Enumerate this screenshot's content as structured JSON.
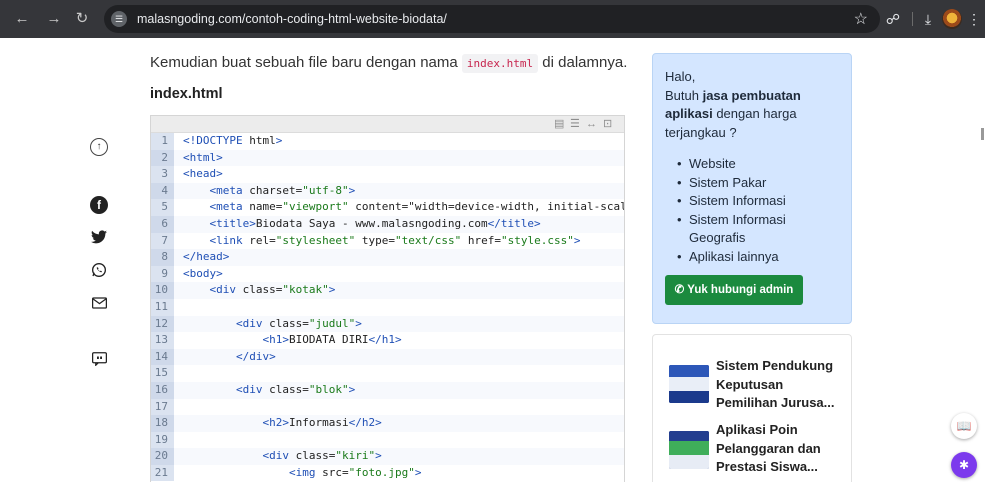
{
  "browser": {
    "url": "malasngoding.com/contoh-coding-html-website-biodata/",
    "icons": [
      "back-icon",
      "forward-icon",
      "reload-icon",
      "site-info-icon",
      "bookmark-star-icon",
      "extensions-icon",
      "download-icon",
      "profile-avatar"
    ]
  },
  "article": {
    "intro_before": "Kemudian buat sebuah file baru dengan nama ",
    "intro_code": "index.html",
    "intro_after": " di dalamnya.",
    "file_heading": "index.html"
  },
  "code_lines": [
    {
      "n": "1",
      "t": "<!DOCTYPE html>"
    },
    {
      "n": "2",
      "t": "<html>"
    },
    {
      "n": "3",
      "t": "<head>"
    },
    {
      "n": "4",
      "t": "    <meta charset=\"utf-8\">"
    },
    {
      "n": "5",
      "t": "    <meta name=\"viewport\" content=\"width=device-width, initial-scale="
    },
    {
      "n": "6",
      "t": "    <title>Biodata Saya - www.malasngoding.com</title>"
    },
    {
      "n": "7",
      "t": "    <link rel=\"stylesheet\" type=\"text/css\" href=\"style.css\">"
    },
    {
      "n": "8",
      "t": "</head>"
    },
    {
      "n": "9",
      "t": "<body>"
    },
    {
      "n": "10",
      "t": "    <div class=\"kotak\">"
    },
    {
      "n": "11",
      "t": ""
    },
    {
      "n": "12",
      "t": "        <div class=\"judul\">"
    },
    {
      "n": "13",
      "t": "            <h1>BIODATA DIRI</h1>"
    },
    {
      "n": "14",
      "t": "        </div>"
    },
    {
      "n": "15",
      "t": ""
    },
    {
      "n": "16",
      "t": "        <div class=\"blok\">"
    },
    {
      "n": "17",
      "t": ""
    },
    {
      "n": "18",
      "t": "            <h2>Informasi</h2>"
    },
    {
      "n": "19",
      "t": ""
    },
    {
      "n": "20",
      "t": "            <div class=\"kiri\">"
    },
    {
      "n": "21",
      "t": "                <img src=\"foto.jpg\">"
    }
  ],
  "promo": {
    "greeting": "Halo,",
    "line_before": "Butuh ",
    "line_bold": "jasa pembuatan aplikasi",
    "line_after": " dengan harga terjangkau ?",
    "services": [
      "Website",
      "Sistem Pakar",
      "Sistem Informasi",
      "Sistem Informasi Geografis",
      "Aplikasi lainnya"
    ],
    "button_label": "Yuk hubungi admin"
  },
  "related": [
    {
      "title": "Sistem Pendukung Keputusan Pemilihan Jurusa..."
    },
    {
      "title": "Aplikasi Poin Pelanggaran dan Prestasi Siswa..."
    }
  ],
  "colors": {
    "chrome_bar": "#35363a",
    "promo_bg": "#d4e6ff",
    "whatsapp_button": "#1b8a3e",
    "code_tag": "#1f4fb5",
    "code_string": "#1a7a1a",
    "inline_code": "#c7254e"
  }
}
